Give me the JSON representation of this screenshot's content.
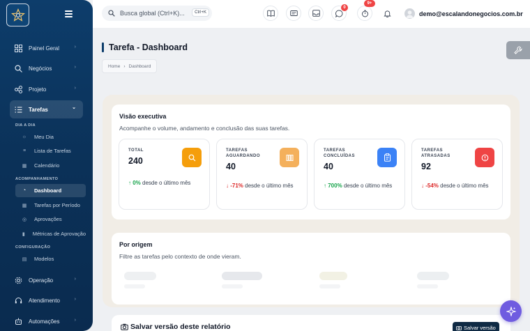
{
  "sidebar": {
    "items": [
      {
        "label": "Painel Geral",
        "icon": "grid-icon"
      },
      {
        "label": "Negócios",
        "icon": "search-icon"
      },
      {
        "label": "Projeto",
        "icon": "flow-icon"
      },
      {
        "label": "Tarefas",
        "icon": "list-icon",
        "expanded": true
      },
      {
        "label": "Operação",
        "icon": "gear-icon"
      },
      {
        "label": "Atendimento",
        "icon": "headset-icon"
      },
      {
        "label": "Automações",
        "icon": "robot-icon"
      }
    ],
    "sections": [
      {
        "label": "DIA A DIA",
        "items": [
          "Meu Dia",
          "Lista de Tarefas",
          "Calendário"
        ]
      },
      {
        "label": "ACOMPANHAMENTO",
        "items": [
          "Dashboard",
          "Tarefas por Período",
          "Aprovações",
          "Métricas de Aprovação"
        ]
      },
      {
        "label": "CONFIGURAÇÃO",
        "items": [
          "Modelos"
        ]
      }
    ],
    "active_item": "Dashboard"
  },
  "topbar": {
    "search_placeholder": "Busca global (Ctrl+K)...",
    "search_shortcut": "Ctrl+K",
    "whatsapp_badge": "0",
    "timer_badge": "9+",
    "user_email": "demo@escalandonegocios.com.br"
  },
  "page": {
    "title": "Tarefa - Dashboard",
    "breadcrumb": [
      "Home",
      "Dashboard"
    ]
  },
  "executive": {
    "title": "Visão executiva",
    "subtitle": "Acompanhe o volume, andamento e conclusão das suas tarefas.",
    "stats": [
      {
        "label": "TOTAL",
        "value": "240",
        "trend": "0%",
        "trend_dir": "up",
        "trend_text": "desde o último mês",
        "icon": "search-icon",
        "color": "#f59e0b"
      },
      {
        "label": "TAREFAS AGUARDANDO",
        "value": "40",
        "trend": "-71%",
        "trend_dir": "down",
        "trend_text": "desde o último mês",
        "icon": "columns-icon",
        "color": "#f4b05c"
      },
      {
        "label": "TAREFAS CONCLUÍDAS",
        "value": "40",
        "trend": "700%",
        "trend_dir": "up",
        "trend_text": "desde o último mês",
        "icon": "clipboard-icon",
        "color": "#3b82f6"
      },
      {
        "label": "TAREFAS ATRASADAS",
        "value": "92",
        "trend": "-54%",
        "trend_dir": "down",
        "trend_text": "desde o último mês",
        "icon": "alert-icon",
        "color": "#ef4444"
      }
    ]
  },
  "origin": {
    "title": "Por origem",
    "subtitle": "Filtre as tarefas pelo contexto de onde vieram."
  },
  "save_report": {
    "title": "Salvar versão deste relatório",
    "button": "Salvar versão"
  }
}
